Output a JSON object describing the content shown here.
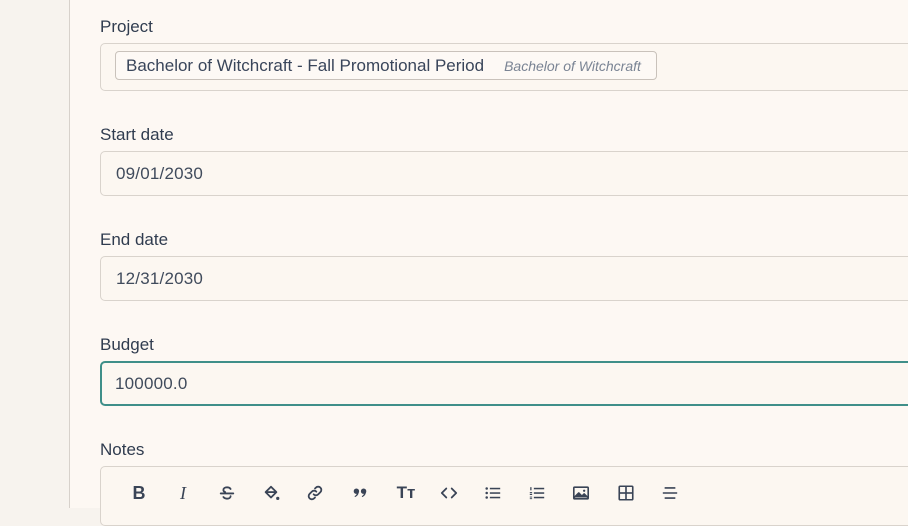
{
  "form": {
    "project": {
      "label": "Project",
      "selected_main": "Bachelor of Witchcraft - Fall Promotional Period",
      "selected_sub": "Bachelor of Witchcraft"
    },
    "start_date": {
      "label": "Start date",
      "value": "09/01/2030"
    },
    "end_date": {
      "label": "End date",
      "value": "12/31/2030"
    },
    "budget": {
      "label": "Budget",
      "value": "100000.0"
    },
    "notes": {
      "label": "Notes"
    }
  },
  "toolbar": {
    "bold": "B",
    "italic": "I",
    "heading": "Tт",
    "icons": [
      "bold-icon",
      "italic-icon",
      "strikethrough-icon",
      "paint-bucket-icon",
      "link-icon",
      "quote-icon",
      "heading-icon",
      "code-icon",
      "bullet-list-icon",
      "numbered-list-icon",
      "image-icon",
      "table-icon",
      "horizontal-rule-icon"
    ]
  },
  "colors": {
    "background": "#fdf8f3",
    "sidebar": "#f7f3ee",
    "focus": "#3f8f89",
    "border": "#d9d3cc",
    "text": "#2f3b4d"
  }
}
